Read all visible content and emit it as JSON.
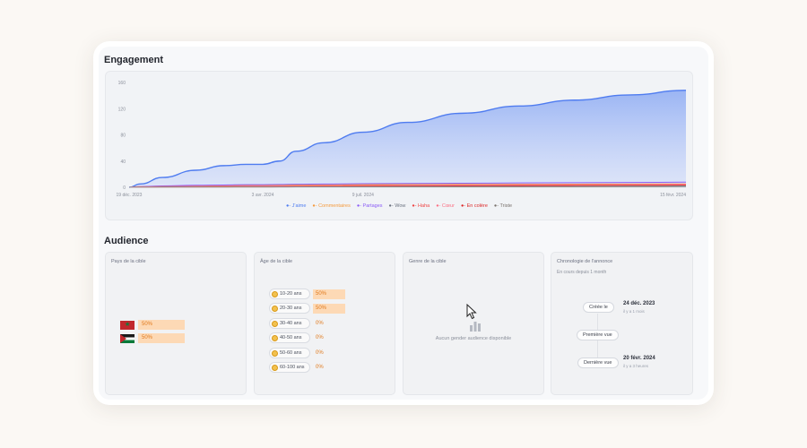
{
  "engagement": {
    "title": "Engagement"
  },
  "chart_data": {
    "type": "area",
    "x_ticks": [
      "19 déc. 2023",
      "3 avr. 2024",
      "9 juil. 2024",
      "15 févr. 2024"
    ],
    "y_ticks": [
      "0",
      "40",
      "80",
      "120",
      "160"
    ],
    "ylim": [
      0,
      160
    ],
    "x": [
      0,
      0.02,
      0.06,
      0.12,
      0.17,
      0.21,
      0.24,
      0.27,
      0.3,
      0.35,
      0.42,
      0.5,
      0.6,
      0.7,
      0.8,
      0.9,
      1.0
    ],
    "series": [
      {
        "name": "J'aime",
        "color": "#4f7cf0",
        "values": [
          0,
          5,
          15,
          26,
          33,
          35,
          35,
          40,
          55,
          68,
          84,
          99,
          113,
          124,
          133,
          141,
          148
        ]
      },
      {
        "name": "Commentaires",
        "color": "#f59a3c",
        "values": [
          0,
          1,
          1.5,
          2,
          2.5,
          3,
          3,
          3.2,
          3.5,
          3.8,
          4,
          4.2,
          4.4,
          4.6,
          4.8,
          5,
          5.2
        ]
      },
      {
        "name": "Partages",
        "color": "#8b5cf6",
        "values": [
          0,
          1,
          2,
          3,
          3.5,
          4,
          4,
          4.2,
          4.6,
          5,
          5.4,
          5.8,
          6.2,
          6.6,
          7,
          7.4,
          7.8
        ]
      },
      {
        "name": "Wow",
        "color": "#6b7280",
        "values": [
          0,
          0.3,
          0.5,
          0.7,
          0.8,
          0.9,
          0.9,
          1,
          1.1,
          1.2,
          1.3,
          1.4,
          1.5,
          1.6,
          1.7,
          1.8,
          1.9
        ]
      },
      {
        "name": "Haha",
        "color": "#ef4444",
        "values": [
          0,
          0.4,
          0.8,
          1.2,
          1.4,
          1.5,
          1.5,
          1.6,
          1.8,
          2,
          2.2,
          2.4,
          2.6,
          2.8,
          3,
          3.2,
          3.4
        ]
      },
      {
        "name": "Cœur",
        "color": "#fb7185",
        "values": [
          0,
          0.6,
          1,
          1.4,
          1.7,
          1.9,
          1.9,
          2,
          2.2,
          2.5,
          2.8,
          3.1,
          3.4,
          3.7,
          4,
          4.3,
          4.6
        ]
      },
      {
        "name": "En colère",
        "color": "#dc2626",
        "values": [
          0,
          0.2,
          0.3,
          0.4,
          0.5,
          0.5,
          0.5,
          0.6,
          0.6,
          0.7,
          0.8,
          0.9,
          1,
          1.1,
          1.2,
          1.3,
          1.4
        ]
      },
      {
        "name": "Triste",
        "color": "#78716c",
        "values": [
          0,
          0.2,
          0.3,
          0.4,
          0.4,
          0.5,
          0.5,
          0.5,
          0.6,
          0.6,
          0.7,
          0.8,
          0.9,
          1,
          1.1,
          1.2,
          1.3
        ]
      }
    ]
  },
  "audience": {
    "title": "Audience",
    "countries": {
      "title": "Pays de la cible",
      "items": [
        {
          "pct": "50%",
          "flag": "morocco-flag",
          "fill": 0.5
        },
        {
          "pct": "50%",
          "flag": "palestine-flag",
          "fill": 0.5
        }
      ]
    },
    "ages": {
      "title": "Âge de la cible",
      "items": [
        {
          "label": "10-20 ans",
          "pct": "50%",
          "fill": 0.5
        },
        {
          "label": "20-30 ans",
          "pct": "50%",
          "fill": 0.5
        },
        {
          "label": "30-40 ans",
          "pct": "0%",
          "fill": 0
        },
        {
          "label": "40-50 ans",
          "pct": "0%",
          "fill": 0
        },
        {
          "label": "50-60 ans",
          "pct": "0%",
          "fill": 0
        },
        {
          "label": "60-100 ans",
          "pct": "0%",
          "fill": 0
        }
      ]
    },
    "gender": {
      "title": "Genre de la cible",
      "empty_text": "Aucun gender audience disponible"
    },
    "timeline": {
      "title": "Chronologie de l'annonce",
      "subtitle": "En cours depuis 1 month",
      "created_label": "Créée le",
      "created_date": "24 déc. 2023",
      "created_ago": "il y a 1 mois",
      "first_seen_label": "Première vue",
      "last_seen_label": "Dernière vue",
      "last_seen_date": "20 févr. 2024",
      "last_seen_ago": "il y a 3 heures"
    }
  },
  "colors": {
    "accent": "#4f7cf0",
    "percent_text": "#e07a1d",
    "percent_fill": "#fdd9b5"
  }
}
